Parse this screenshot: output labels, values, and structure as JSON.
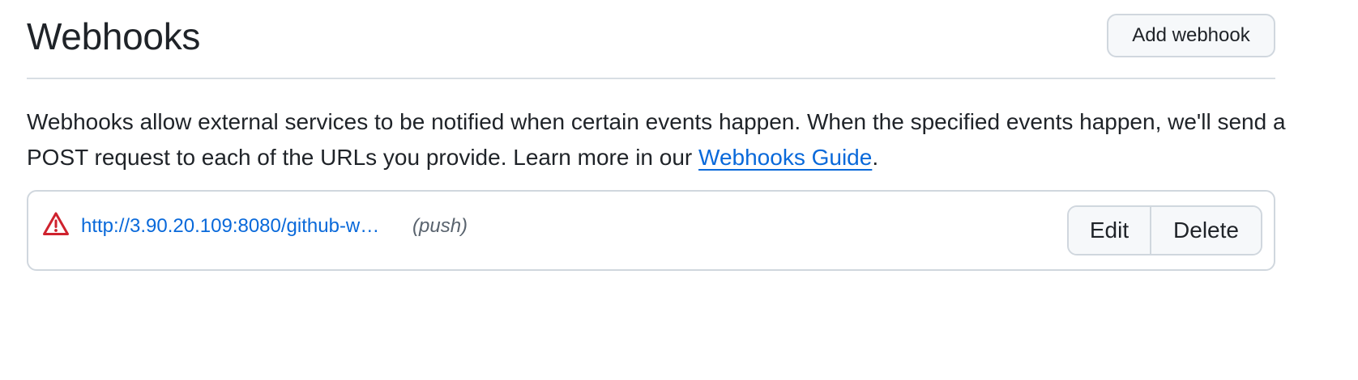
{
  "header": {
    "title": "Webhooks",
    "add_button_label": "Add webhook"
  },
  "description": {
    "text_before_link": "Webhooks allow external services to be notified when certain events happen. When the specified events happen, we'll send a POST request to each of the URLs you provide. Learn more in our ",
    "link_label": "Webhooks Guide",
    "text_after_link": "."
  },
  "webhooks": [
    {
      "status_icon": "alert-triangle-icon",
      "url": "http://3.90.20.109:8080/github-w…",
      "events": "(push)",
      "edit_label": "Edit",
      "delete_label": "Delete"
    }
  ],
  "colors": {
    "link": "#0969da",
    "warning": "#cf222e",
    "border": "#d0d7de",
    "button_bg": "#f6f8fa",
    "muted_text": "#59636e"
  }
}
